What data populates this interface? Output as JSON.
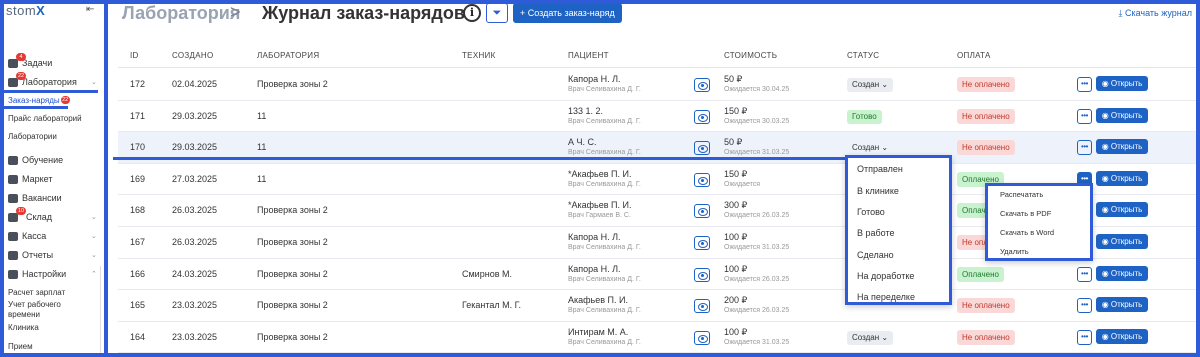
{
  "brand": {
    "logo": "stom",
    "logo_accent": "X"
  },
  "sidebar": {
    "items": [
      {
        "label": "Задачи",
        "badge": "4"
      },
      {
        "label": "Лаборатория",
        "badge": "22"
      },
      {
        "label": "Обучение"
      },
      {
        "label": "Маркет"
      },
      {
        "label": "Вакансии"
      },
      {
        "label": "Склад",
        "badge": "10"
      },
      {
        "label": "Касса"
      },
      {
        "label": "Отчеты"
      },
      {
        "label": "Настройки"
      }
    ],
    "lab_sub": [
      {
        "label": "Заказ-наряды",
        "badge": "22"
      },
      {
        "label": "Прайс лабораторий"
      },
      {
        "label": "Лаборатории"
      }
    ],
    "settings_sub": [
      {
        "label": "Расчет зарплат"
      },
      {
        "label": "Учет рабочего"
      },
      {
        "label": "времени"
      },
      {
        "label": "Клиника"
      },
      {
        "label": "Прием"
      }
    ]
  },
  "header": {
    "crumb_root": "Лаборатория",
    "crumb_sep": ">",
    "title": "Журнал заказ-нарядов",
    "create_label": "+ Создать заказ-наряд",
    "download_label": "⤓ Скачать журнал"
  },
  "columns": [
    "ID",
    "СОЗДАНО",
    "ЛАБОРАТОРИЯ",
    "ТЕХНИК",
    "ПАЦИЕНТ",
    "СТОИМОСТЬ",
    "СТАТУС",
    "ОПЛАТА"
  ],
  "rows": [
    {
      "id": "172",
      "created": "02.04.2025",
      "lab": "Проверка зоны 2",
      "tech": "",
      "patient": "Капора Н. Л.",
      "doctor": "Врач Селивахина Д. Г.",
      "price": "50 ₽",
      "expected": "Ожидается 30.04.25",
      "status": "Создан ⌄",
      "status_kind": "created",
      "payment": "Не оплачено",
      "pay_kind": "unpaid",
      "open": "◉ Открыть"
    },
    {
      "id": "171",
      "created": "29.03.2025",
      "lab": "11",
      "tech": "",
      "patient": "133 1. 2.",
      "doctor": "Врач Селивахина Д. Г.",
      "price": "150 ₽",
      "expected": "Ожидается 30.03.25",
      "status": "Готово",
      "status_kind": "ready",
      "payment": "Не оплачено",
      "pay_kind": "unpaid",
      "open": "◉ Открыть"
    },
    {
      "id": "170",
      "created": "29.03.2025",
      "lab": "11",
      "tech": "",
      "patient": "А Ч. С.",
      "doctor": "Врач Селивахина Д. Г.",
      "price": "50 ₽",
      "expected": "Ожидается 31.03.25",
      "status": "Создан ⌄",
      "status_kind": "plain",
      "payment": "Не оплачено",
      "pay_kind": "unpaid",
      "open": "◉ Открыть"
    },
    {
      "id": "169",
      "created": "27.03.2025",
      "lab": "11",
      "tech": "",
      "patient": "*Акафьев П. И.",
      "doctor": "Врач Селивахина Д. Г.",
      "price": "150 ₽",
      "expected": "Ожидается",
      "status": "",
      "status_kind": "none",
      "payment": "Оплачено",
      "pay_kind": "paid",
      "open": "◉ Открыть"
    },
    {
      "id": "168",
      "created": "26.03.2025",
      "lab": "Проверка зоны 2",
      "tech": "",
      "patient": "*Акафьев П. И.",
      "doctor": "Врач Гармаев В. С.",
      "price": "300 ₽",
      "expected": "Ожидается 26.03.25",
      "status": "",
      "status_kind": "none",
      "payment": "Оплачено",
      "pay_kind": "paid",
      "open": "◉ Открыть"
    },
    {
      "id": "167",
      "created": "26.03.2025",
      "lab": "Проверка зоны 2",
      "tech": "",
      "patient": "Капора Н. Л.",
      "doctor": "Врач Селивахина Д. Г.",
      "price": "100 ₽",
      "expected": "Ожидается 31.03.25",
      "status": "",
      "status_kind": "none",
      "payment": "Не оплачено",
      "pay_kind": "unpaid",
      "open": "◉ Открыть"
    },
    {
      "id": "166",
      "created": "24.03.2025",
      "lab": "Проверка зоны 2",
      "tech": "Смирнов М.",
      "patient": "Капора Н. Л.",
      "doctor": "Врач Селивахина Д. Г.",
      "price": "100 ₽",
      "expected": "Ожидается 26.03.25",
      "status": "",
      "status_kind": "none",
      "payment": "Оплачено",
      "pay_kind": "paid",
      "open": "◉ Открыть"
    },
    {
      "id": "165",
      "created": "23.03.2025",
      "lab": "Проверка зоны 2",
      "tech": "Гекантал М. Г.",
      "patient": "Акафьев П. И.",
      "doctor": "Врач Селивахина Д. Г.",
      "price": "200 ₽",
      "expected": "Ожидается 26.03.25",
      "status": "",
      "status_kind": "none",
      "payment": "Не оплачено",
      "pay_kind": "unpaid",
      "open": "◉ Открыть"
    },
    {
      "id": "164",
      "created": "23.03.2025",
      "lab": "Проверка зоны 2",
      "tech": "",
      "patient": "Интирам М. А.",
      "doctor": "Врач Селивахина Д. Г.",
      "price": "100 ₽",
      "expected": "Ожидается 31.03.25",
      "status": "Создан ⌄",
      "status_kind": "created",
      "payment": "Не оплачено",
      "pay_kind": "unpaid",
      "open": "◉ Открыть"
    }
  ],
  "status_menu": [
    "Отправлен",
    "В клинике",
    "Готово",
    "В работе",
    "Сделано",
    "На доработке",
    "На переделке"
  ],
  "action_menu": [
    "Распечатать",
    "Скачать в PDF",
    "Скачать в Word",
    "Удалить"
  ],
  "colors": {
    "accent": "#1e63c4",
    "frame": "#2f5bd8",
    "paid_bg": "#c9f2cf",
    "unpaid_bg": "#fbd8d8"
  }
}
